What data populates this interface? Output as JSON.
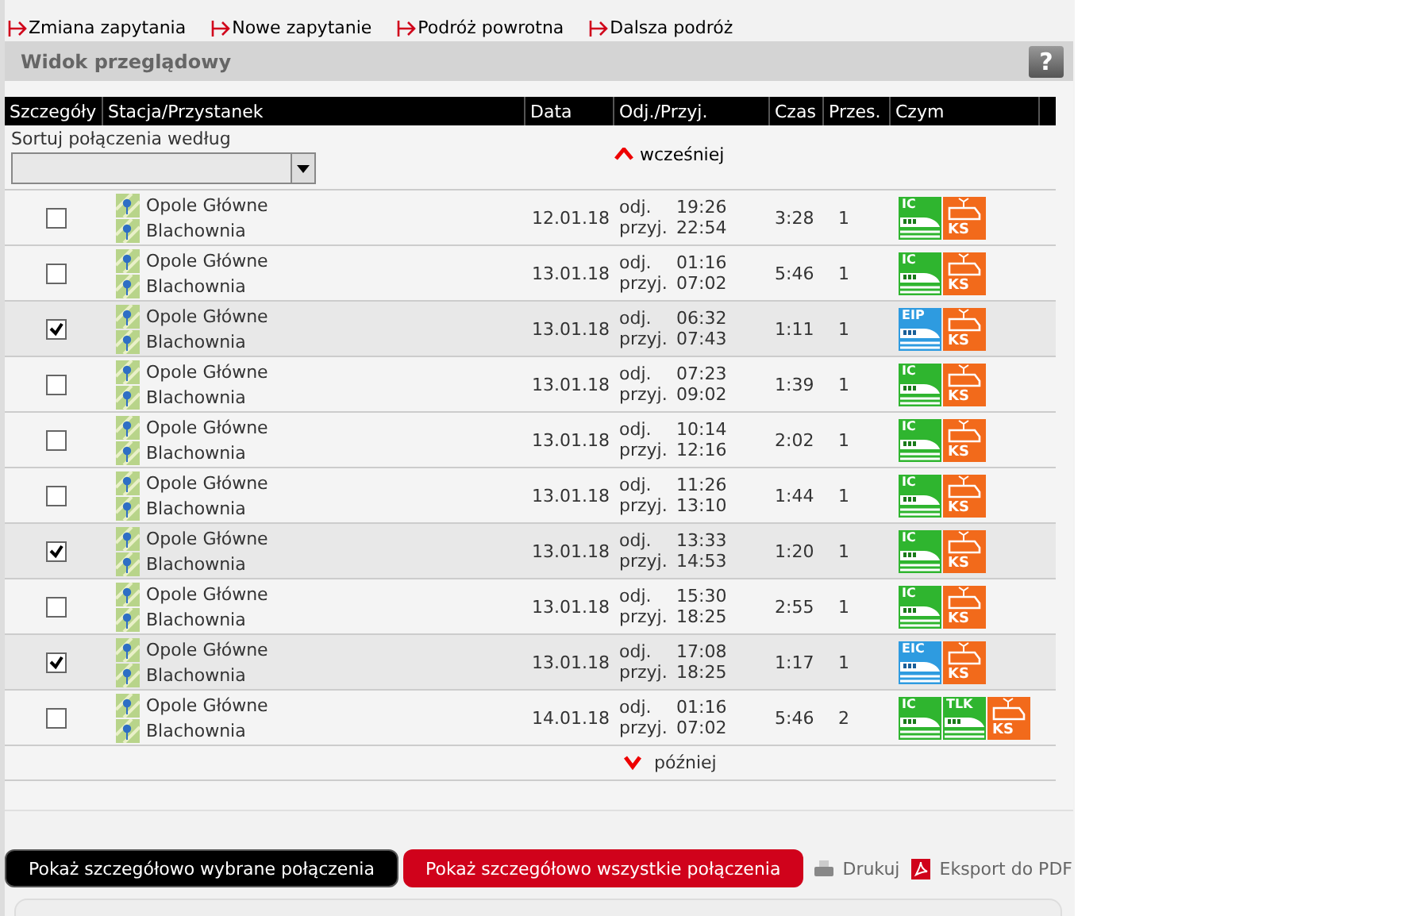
{
  "nav_links": [
    "Zmiana zapytania",
    "Nowe zapytanie",
    "Podróż powrotna",
    "Dalsza podróż"
  ],
  "panel": {
    "title": "Widok przeglądowy",
    "help": "?"
  },
  "table": {
    "columns": [
      "Szczegóły",
      "Stacja/Przystanek",
      "Data",
      "Odj./Przyj.",
      "Czas",
      "Przes.",
      "Czym"
    ],
    "sort_label": "Sortuj połączenia według",
    "earlier": "wcześniej",
    "later": "później",
    "rows": [
      {
        "checked": false,
        "from": "Opole Główne",
        "to": "Blachownia",
        "date": "12.01.18",
        "dep_label": "odj.",
        "dep": "19:26",
        "arr_label": "przyj.",
        "arr": "22:54",
        "duration": "3:28",
        "changes": "1",
        "trains": [
          {
            "kind": "ic",
            "label": "IC"
          },
          {
            "kind": "ks",
            "label": "KS"
          }
        ]
      },
      {
        "checked": false,
        "from": "Opole Główne",
        "to": "Blachownia",
        "date": "13.01.18",
        "dep_label": "odj.",
        "dep": "01:16",
        "arr_label": "przyj.",
        "arr": "07:02",
        "duration": "5:46",
        "changes": "1",
        "trains": [
          {
            "kind": "ic",
            "label": "IC"
          },
          {
            "kind": "ks",
            "label": "KS"
          }
        ]
      },
      {
        "checked": true,
        "from": "Opole Główne",
        "to": "Blachownia",
        "date": "13.01.18",
        "dep_label": "odj.",
        "dep": "06:32",
        "arr_label": "przyj.",
        "arr": "07:43",
        "duration": "1:11",
        "changes": "1",
        "trains": [
          {
            "kind": "eip",
            "label": "EIP"
          },
          {
            "kind": "ks",
            "label": "KS"
          }
        ]
      },
      {
        "checked": false,
        "from": "Opole Główne",
        "to": "Blachownia",
        "date": "13.01.18",
        "dep_label": "odj.",
        "dep": "07:23",
        "arr_label": "przyj.",
        "arr": "09:02",
        "duration": "1:39",
        "changes": "1",
        "trains": [
          {
            "kind": "ic",
            "label": "IC"
          },
          {
            "kind": "ks",
            "label": "KS"
          }
        ]
      },
      {
        "checked": false,
        "from": "Opole Główne",
        "to": "Blachownia",
        "date": "13.01.18",
        "dep_label": "odj.",
        "dep": "10:14",
        "arr_label": "przyj.",
        "arr": "12:16",
        "duration": "2:02",
        "changes": "1",
        "trains": [
          {
            "kind": "ic",
            "label": "IC"
          },
          {
            "kind": "ks",
            "label": "KS"
          }
        ]
      },
      {
        "checked": false,
        "from": "Opole Główne",
        "to": "Blachownia",
        "date": "13.01.18",
        "dep_label": "odj.",
        "dep": "11:26",
        "arr_label": "przyj.",
        "arr": "13:10",
        "duration": "1:44",
        "changes": "1",
        "trains": [
          {
            "kind": "ic",
            "label": "IC"
          },
          {
            "kind": "ks",
            "label": "KS"
          }
        ]
      },
      {
        "checked": true,
        "from": "Opole Główne",
        "to": "Blachownia",
        "date": "13.01.18",
        "dep_label": "odj.",
        "dep": "13:33",
        "arr_label": "przyj.",
        "arr": "14:53",
        "duration": "1:20",
        "changes": "1",
        "trains": [
          {
            "kind": "ic",
            "label": "IC"
          },
          {
            "kind": "ks",
            "label": "KS"
          }
        ]
      },
      {
        "checked": false,
        "from": "Opole Główne",
        "to": "Blachownia",
        "date": "13.01.18",
        "dep_label": "odj.",
        "dep": "15:30",
        "arr_label": "przyj.",
        "arr": "18:25",
        "duration": "2:55",
        "changes": "1",
        "trains": [
          {
            "kind": "ic",
            "label": "IC"
          },
          {
            "kind": "ks",
            "label": "KS"
          }
        ]
      },
      {
        "checked": true,
        "from": "Opole Główne",
        "to": "Blachownia",
        "date": "13.01.18",
        "dep_label": "odj.",
        "dep": "17:08",
        "arr_label": "przyj.",
        "arr": "18:25",
        "duration": "1:17",
        "changes": "1",
        "trains": [
          {
            "kind": "eip",
            "label": "EIC"
          },
          {
            "kind": "ks",
            "label": "KS"
          }
        ]
      },
      {
        "checked": false,
        "from": "Opole Główne",
        "to": "Blachownia",
        "date": "14.01.18",
        "dep_label": "odj.",
        "dep": "01:16",
        "arr_label": "przyj.",
        "arr": "07:02",
        "duration": "5:46",
        "changes": "2",
        "trains": [
          {
            "kind": "ic",
            "label": "IC"
          },
          {
            "kind": "ic",
            "label": "TLK"
          },
          {
            "kind": "ks",
            "label": "KS"
          }
        ]
      }
    ]
  },
  "actions": {
    "show_selected": "Pokaż szczegółowo wybrane połączenia",
    "show_all": "Pokaż szczegółowo wszystkie połączenia",
    "print": "Drukuj",
    "export": "Eksport do PDF"
  }
}
